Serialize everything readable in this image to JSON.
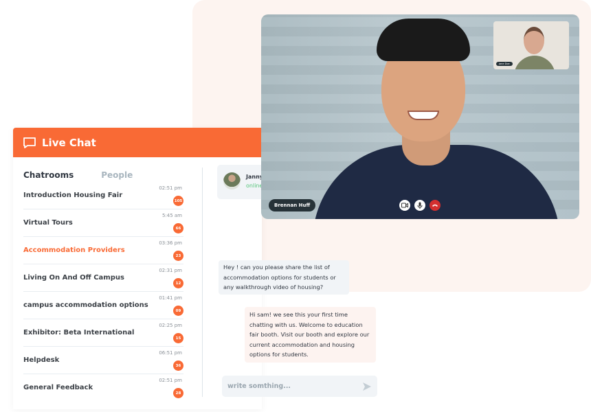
{
  "chat": {
    "title": "Live Chat",
    "tabs": [
      "Chatrooms",
      "People"
    ],
    "rooms": [
      {
        "name": "Introduction Housing Fair",
        "time": "02:51 pm",
        "count": "105"
      },
      {
        "name": "Virtual Tours",
        "time": "5:45 am",
        "count": "66"
      },
      {
        "name": "Accommodation Providers",
        "time": "03:36 pm",
        "count": "23",
        "active": true
      },
      {
        "name": "Living On And Off Campus",
        "time": "02:31 pm",
        "count": "12"
      },
      {
        "name": "campus accommodation options",
        "time": "01:41 pm",
        "count": "09"
      },
      {
        "name": "Exhibitor: Beta International",
        "time": "02:25 pm",
        "count": "15"
      },
      {
        "name": "Helpdesk",
        "time": "06:51 pm",
        "count": "36"
      },
      {
        "name": "General Feedback",
        "time": "02:51 pm",
        "count": "28"
      }
    ],
    "contact": {
      "name": "Janny",
      "status": "online"
    },
    "messages": [
      "Hey ! can you please share the list of accommodation options for students or any walkthrough video of housing?",
      "Hi sam! we see this your first time chatting with us. Welcome to education fair booth. Visit our booth and explore our current accommodation and housing options for students."
    ],
    "input_placeholder": "write somthing..."
  },
  "video": {
    "main_name": "Brennan Huff",
    "thumb_name": "Jane Doe",
    "controls": [
      "camera-icon",
      "microphone-icon",
      "end-call-icon"
    ]
  },
  "colors": {
    "accent": "#f96a35",
    "online": "#55c47a",
    "end_call": "#d32f2f"
  }
}
